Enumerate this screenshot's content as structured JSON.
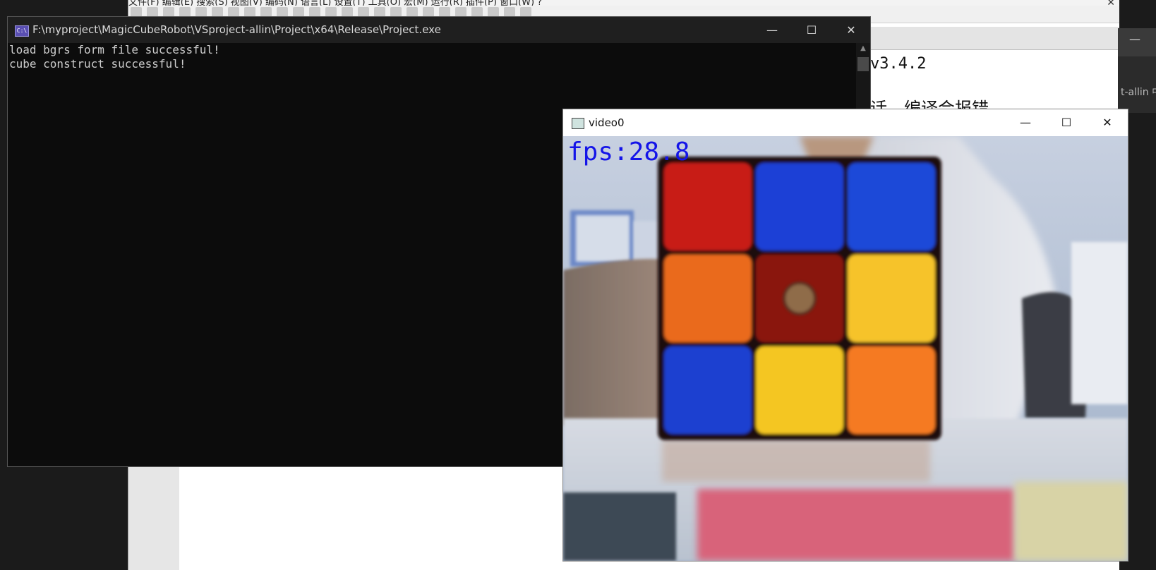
{
  "editor": {
    "menu_text": "文件(F)  编辑(E)  搜索(S)  视图(V)  编码(N)  语言(L)  设置(T)  工具(O)  宏(M)  运行(R)  插件(P)  窗口(W)  ?",
    "text_line1": "v3.4.2",
    "text_line2": "话，编译会报错",
    "close_glyph": "✕"
  },
  "edge_window": {
    "min_glyph": "—",
    "label": "t-allin 中"
  },
  "console": {
    "title": "F:\\myproject\\MagicCubeRobot\\VSproject-allin\\Project\\x64\\Release\\Project.exe",
    "icon_text": "C:\\",
    "lines": [
      "load bgrs form file successful!",
      "cube construct successful!"
    ],
    "minimize_glyph": "—",
    "maximize_glyph": "☐",
    "close_glyph": "✕",
    "scroll_up_glyph": "▲"
  },
  "video": {
    "title": "video0",
    "fps_text": "fps:28.8",
    "minimize_glyph": "—",
    "maximize_glyph": "☐",
    "close_glyph": "✕",
    "cube_face_colors": [
      [
        "#c81a14",
        "#1a3fd6",
        "#1c48d8"
      ],
      [
        "#ea6a1c",
        "#8a1210",
        "#f6c32a"
      ],
      [
        "#1f3fd0",
        "#f4c623",
        "#f57a20"
      ]
    ]
  }
}
